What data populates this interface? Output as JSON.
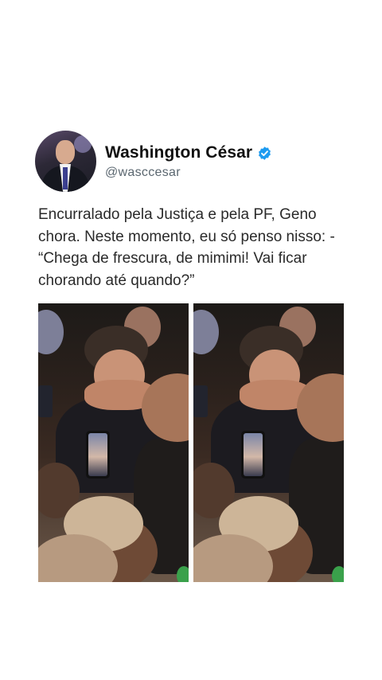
{
  "profile": {
    "name": "Washington César",
    "handle": "@wasccesar",
    "verified_color": "#1d9bf0"
  },
  "tweet": {
    "lines": [
      "Encurralado pela Justiça e pela PF, Geno",
      "chora. Neste momento, eu só penso nisso: -",
      "“Chega de frescura, de mimimi! Vai ficar",
      "chorando até quando?”"
    ]
  },
  "media": {
    "frames": [
      "photo-left",
      "photo-right"
    ]
  },
  "icons": {
    "verified": "verified-badge-icon"
  }
}
